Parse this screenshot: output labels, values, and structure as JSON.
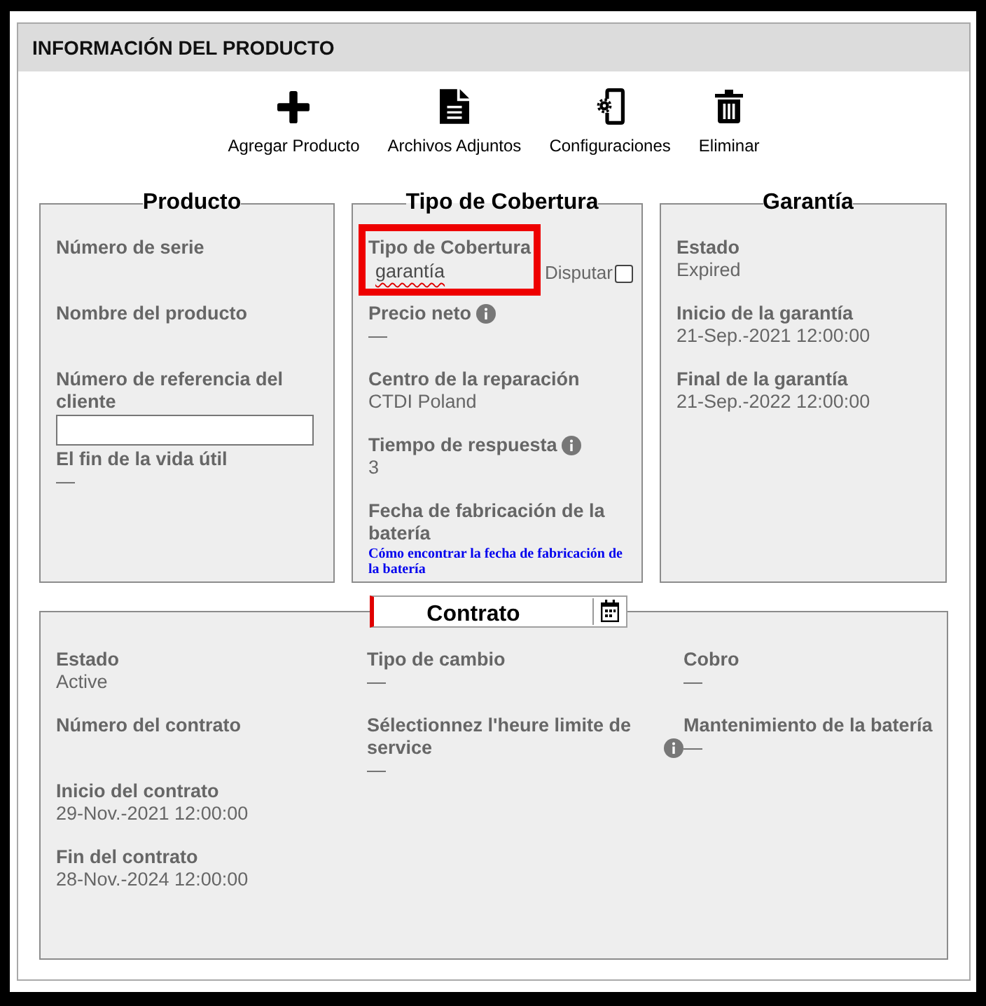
{
  "header": {
    "title": "INFORMACIÓN DEL PRODUCTO"
  },
  "toolbar": [
    {
      "kind": "add",
      "label": "Agregar Producto"
    },
    {
      "kind": "attachments",
      "label": "Archivos Adjuntos"
    },
    {
      "kind": "settings",
      "label": "Configuraciones"
    },
    {
      "kind": "delete",
      "label": "Eliminar"
    }
  ],
  "sections": [
    {
      "title": "Producto",
      "fields": [
        {
          "kind": "text",
          "label": "Número de serie"
        },
        {
          "kind": "text",
          "label": "Nombre del producto"
        },
        {
          "kind": "input",
          "label": "Número de referencia del cliente"
        },
        {
          "kind": "text",
          "label": "El fin de la vida útil",
          "value": "—"
        }
      ]
    },
    {
      "title": "Tipo de Cobertura",
      "fields": [
        {
          "kind": "coverage",
          "label": "Tipo de Cobertura",
          "value": "garantía",
          "misspelled": true,
          "highlighted": true,
          "dispute": {
            "label": "Disputar",
            "checked": false
          }
        },
        {
          "kind": "text",
          "label": "Precio neto",
          "info": true,
          "value": "—"
        },
        {
          "kind": "text",
          "label": "Centro de la reparación",
          "value": "CTDI Poland"
        },
        {
          "kind": "text",
          "label": "Tiempo de respuesta",
          "info": true,
          "value": "3"
        },
        {
          "kind": "text",
          "label": "Fecha de fabricación de la batería",
          "link": "Cómo encontrar la fecha de fabricación de la batería"
        }
      ]
    },
    {
      "title": "Garantía",
      "fields": [
        {
          "kind": "text",
          "label": "Estado",
          "value": "Expired"
        },
        {
          "kind": "text",
          "label": "Inicio de la garantía",
          "value": "21-Sep.-2021 12:00:00"
        },
        {
          "kind": "text",
          "label": "Final de la garantía",
          "value": "21-Sep.-2022 12:00:00"
        }
      ]
    }
  ],
  "contract": {
    "title": "Contrato",
    "date_field": {
      "required": true
    },
    "columns": [
      [
        {
          "kind": "text",
          "label": "Estado",
          "value": "Active"
        },
        {
          "kind": "text",
          "label": "Número del contrato"
        },
        {
          "kind": "text",
          "label": "Inicio del contrato",
          "value": "29-Nov.-2021 12:00:00"
        },
        {
          "kind": "text",
          "label": "Fin del contrato",
          "value": "28-Nov.-2024 12:00:00"
        }
      ],
      [
        {
          "kind": "text",
          "label": "Tipo de cambio",
          "value": "—"
        },
        {
          "kind": "text",
          "label": "Sélectionnez l'heure limite de service",
          "info": true,
          "value": "—"
        }
      ],
      [
        {
          "kind": "text",
          "label": "Cobro",
          "value": "—"
        },
        {
          "kind": "text",
          "label": "Mantenimiento de la batería",
          "value": "—"
        }
      ]
    ]
  }
}
